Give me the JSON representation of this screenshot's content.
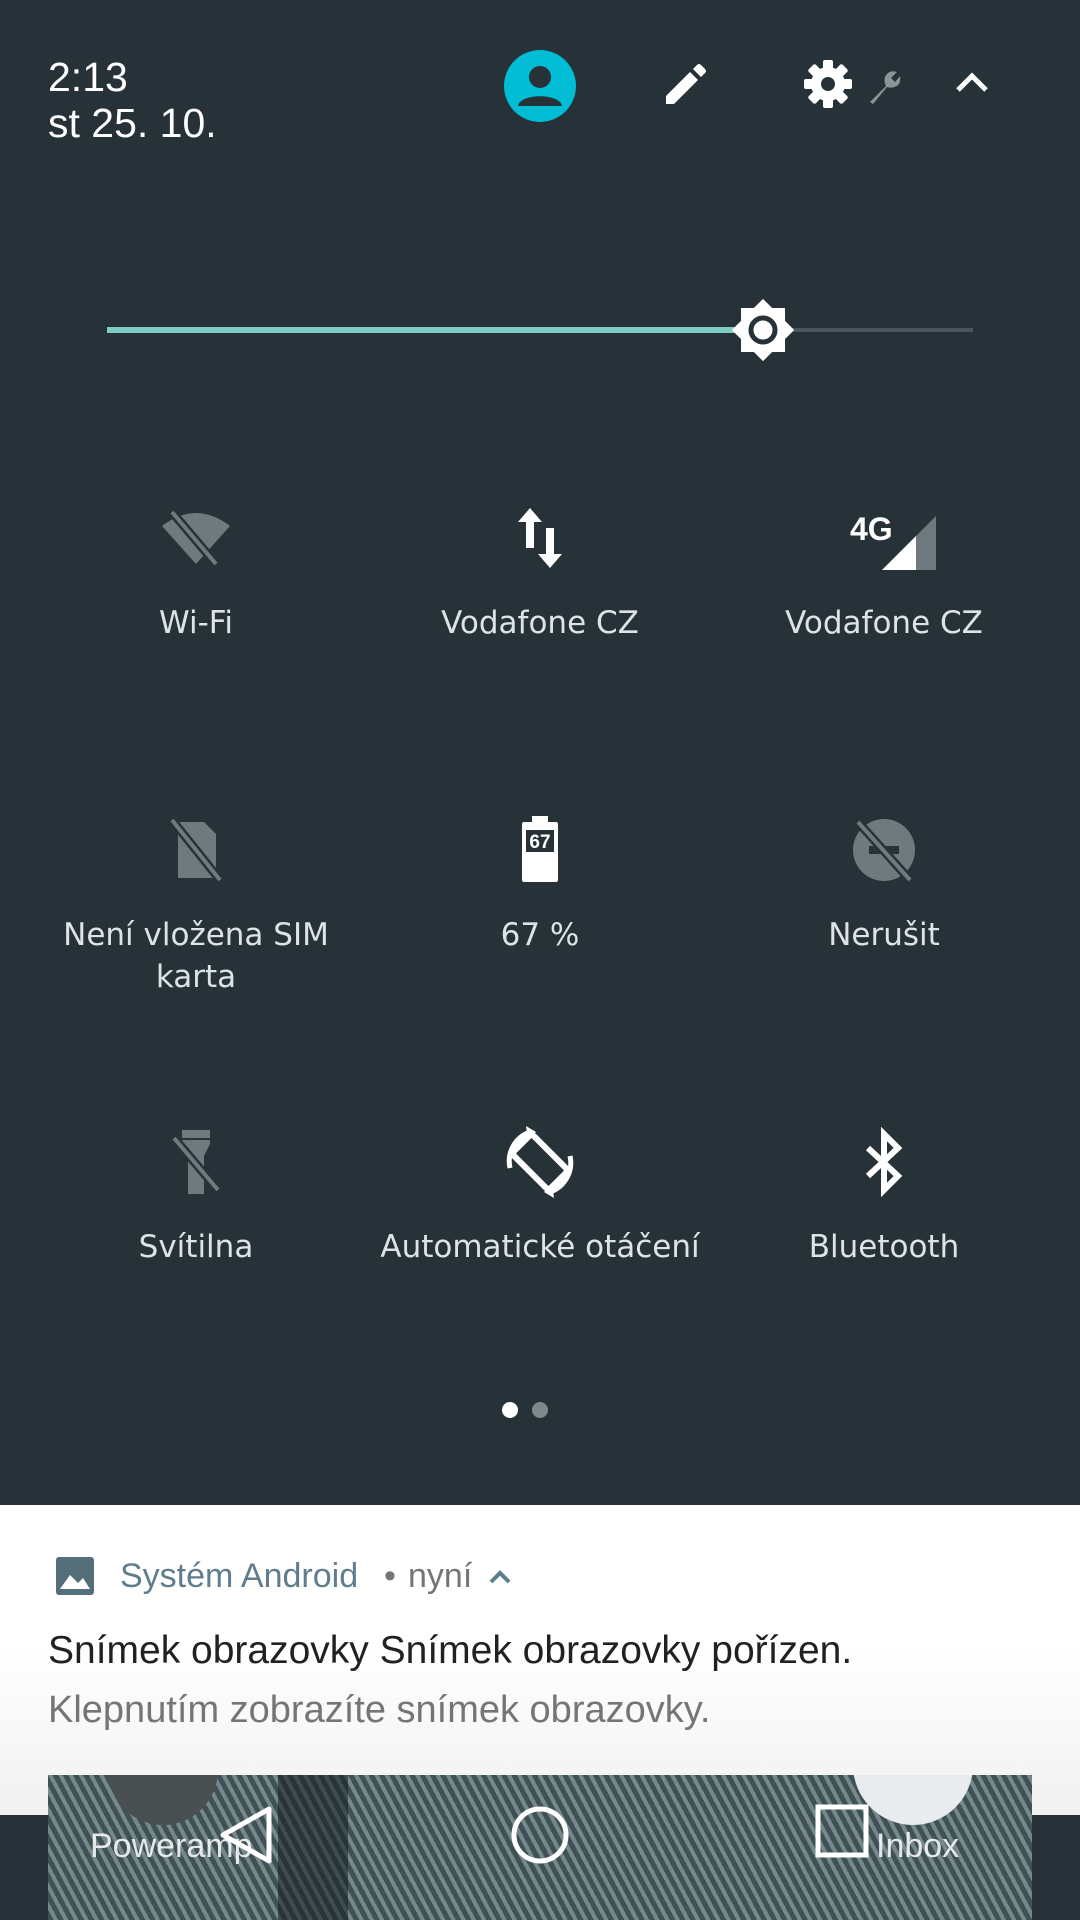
{
  "header": {
    "time": "2:13",
    "date": "st 25. 10."
  },
  "brightness": {
    "level": 0.757
  },
  "tiles": [
    {
      "label": "Wi-Fi",
      "icon": "wifi-off-icon",
      "state": "off"
    },
    {
      "label": "Vodafone CZ",
      "icon": "mobile-data-icon",
      "state": "on"
    },
    {
      "label": "Vodafone CZ",
      "icon": "cellular-signal-icon",
      "state": "on",
      "badge": "4G"
    },
    {
      "label": "Není vložena SIM karta",
      "icon": "no-sim-icon",
      "state": "off"
    },
    {
      "label": "67 %",
      "icon": "battery-icon",
      "state": "on",
      "badge": "67"
    },
    {
      "label": "Nerušit",
      "icon": "do-not-disturb-off-icon",
      "state": "off"
    },
    {
      "label": "Svítilna",
      "icon": "flashlight-off-icon",
      "state": "off"
    },
    {
      "label": "Automatické otáčení",
      "icon": "auto-rotate-icon",
      "state": "on"
    },
    {
      "label": "Bluetooth",
      "icon": "bluetooth-icon",
      "state": "on"
    }
  ],
  "pager": {
    "pages": 2,
    "current": 1
  },
  "notification": {
    "app": "Systém Android",
    "separator": "•",
    "when": "nyní",
    "title": "Snímek obrazovky Snímek obrazovky pořízen.",
    "body": "Klepnutím zobrazíte snímek obrazovky."
  },
  "preview": {
    "left_app": "Poweramp",
    "right_app": "Inbox"
  },
  "colors": {
    "background": "#263238",
    "accent": "#80cbc4",
    "avatar": "#00bcd4",
    "tile_on": "#ffffff",
    "tile_off": "#6f7a7f",
    "notification_app": "#5f7d8c"
  }
}
